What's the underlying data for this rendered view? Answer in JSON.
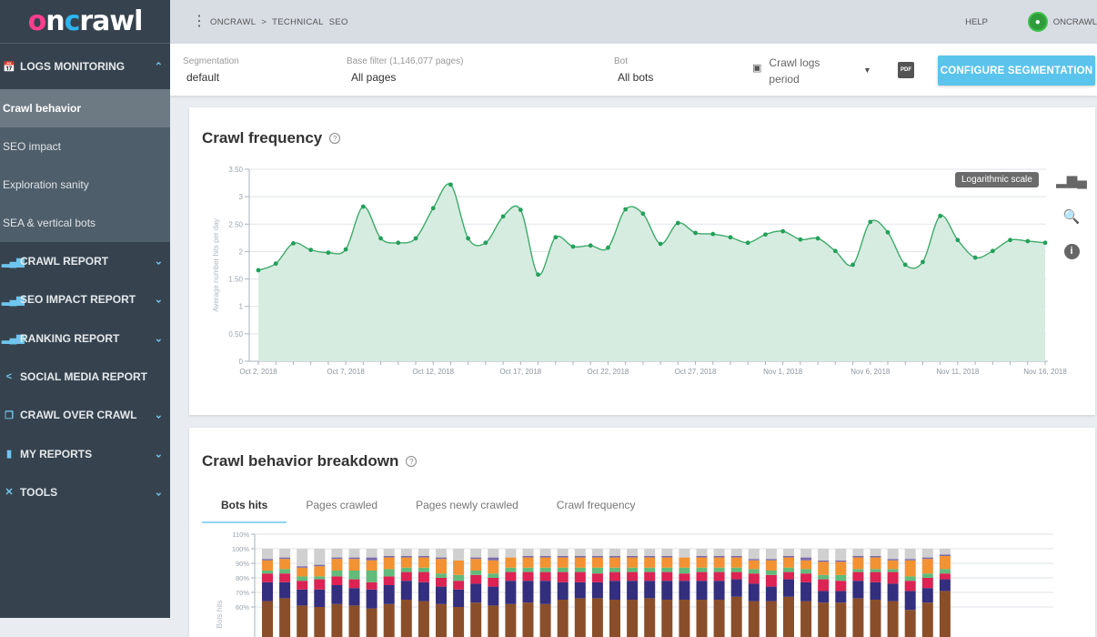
{
  "brand": {
    "logo_parts": [
      "o",
      "n",
      "c",
      "rawl"
    ]
  },
  "topbar": {
    "breadcrumb": [
      "ONCRAWL",
      "TECHNICAL",
      "SEO"
    ],
    "breadcrumb_separator": ">",
    "help_label": "HELP",
    "user_label": "ONCRAWL"
  },
  "sidebar": {
    "open_section": {
      "label": "LOGS MONITORING",
      "icon": "calendar-icon",
      "chevron": "chevron-up-icon"
    },
    "sub_items": [
      {
        "label": "Crawl behavior",
        "active": true
      },
      {
        "label": "SEO impact",
        "active": false
      },
      {
        "label": "Exploration sanity",
        "active": false
      },
      {
        "label": "SEA & vertical bots",
        "active": false
      }
    ],
    "sections": [
      {
        "label": "CRAWL REPORT",
        "icon": "bar-chart-icon",
        "has_chevron": true
      },
      {
        "label": "SEO IMPACT REPORT",
        "icon": "bar-chart-icon",
        "has_chevron": true
      },
      {
        "label": "RANKING REPORT",
        "icon": "bar-chart-icon",
        "has_chevron": true
      },
      {
        "label": "SOCIAL MEDIA REPORT",
        "icon": "share-icon",
        "has_chevron": false
      },
      {
        "label": "CRAWL OVER CRAWL",
        "icon": "copy-icon",
        "has_chevron": true
      },
      {
        "label": "MY REPORTS",
        "icon": "folder-icon",
        "has_chevron": true
      },
      {
        "label": "TOOLS",
        "icon": "tools-icon",
        "has_chevron": true
      }
    ]
  },
  "filters": {
    "segmentation": {
      "label": "Segmentation",
      "value": "default"
    },
    "base_filter": {
      "label": "Base filter (1,146,077 pages)",
      "value": "All pages"
    },
    "bot": {
      "label": "Bot",
      "value": "All bots"
    },
    "period": {
      "line1": "Crawl logs",
      "line2": "period"
    },
    "pdf_label": "PDF",
    "configure_button": "CONFIGURE SEGMENTATION"
  },
  "crawl_frequency_card": {
    "title": "Crawl frequency",
    "help": "?",
    "log_scale_label": "Logarithmic scale"
  },
  "breakdown_card": {
    "title": "Crawl behavior breakdown",
    "help": "?",
    "tabs": [
      {
        "label": "Bots hits",
        "active": true
      },
      {
        "label": "Pages crawled",
        "active": false
      },
      {
        "label": "Pages newly crawled",
        "active": false
      },
      {
        "label": "Crawl frequency",
        "active": false
      }
    ]
  },
  "colors": {
    "accent": "#5ac4ec",
    "line": "#3daa6a",
    "area": "#d5ebdf",
    "stack": [
      "#8a4f2a",
      "#342e7e",
      "#dc2353",
      "#62bb7a",
      "#f29233",
      "#7c6aa8",
      "#d0d0d0"
    ]
  },
  "chart_data": [
    {
      "type": "area",
      "title": "Crawl frequency",
      "xlabel": "",
      "ylabel": "Average number hits per day",
      "ylim": [
        0,
        3.5
      ],
      "yticks": [
        "0",
        "0.50",
        "1",
        "1.50",
        "2",
        "2.50",
        "3",
        "3.50"
      ],
      "ytick_values": [
        0,
        0.5,
        1,
        1.5,
        2,
        2.5,
        3,
        3.5
      ],
      "xtick_labels": [
        "Oct 2, 2018",
        "Oct 7, 2018",
        "Oct 12, 2018",
        "Oct 17, 2018",
        "Oct 22, 2018",
        "Oct 27, 2018",
        "Nov 1, 2018",
        "Nov 6, 2018",
        "Nov 11, 2018",
        "Nov 16, 2018"
      ],
      "xtick_every": 5,
      "grid": true,
      "x_start": "Oct 2, 2018",
      "values": [
        1.66,
        1.78,
        2.15,
        2.03,
        1.98,
        2.04,
        2.82,
        2.24,
        2.16,
        2.24,
        2.79,
        3.22,
        2.24,
        2.16,
        2.64,
        2.76,
        1.58,
        2.26,
        2.09,
        2.11,
        2.07,
        2.77,
        2.69,
        2.14,
        2.52,
        2.34,
        2.32,
        2.26,
        2.16,
        2.31,
        2.37,
        2.22,
        2.24,
        2.01,
        1.76,
        2.54,
        2.35,
        1.76,
        1.81,
        2.65,
        2.21,
        1.89,
        2.01,
        2.21,
        2.19,
        2.16
      ]
    },
    {
      "type": "bar",
      "stacked": true,
      "title": "Bots hits",
      "ylabel": "Bots hits",
      "ylim_visible": [
        55,
        110
      ],
      "yticks": [
        "60%",
        "70%",
        "80%",
        "90%",
        "100%",
        "110%"
      ],
      "ytick_values": [
        60,
        70,
        80,
        90,
        100,
        110
      ],
      "series_top_percent_by_bar": {
        "brown": [
          64,
          66,
          61,
          60,
          62,
          61,
          59,
          62,
          65,
          64,
          62,
          60,
          63,
          61,
          62,
          63,
          62,
          65,
          66,
          66,
          65,
          65,
          66,
          65,
          65,
          65,
          65,
          67,
          64,
          64,
          67,
          64,
          63,
          63,
          66,
          65,
          64,
          58,
          63,
          71
        ],
        "navy": [
          77,
          77,
          72,
          72,
          75,
          73,
          72,
          75,
          78,
          77,
          74,
          72,
          76,
          74,
          78,
          78,
          78,
          77,
          77,
          77,
          78,
          78,
          78,
          78,
          78,
          78,
          78,
          79,
          76,
          74,
          79,
          77,
          71,
          71,
          78,
          77,
          76,
          71,
          73,
          79
        ],
        "red": [
          83,
          83,
          78,
          79,
          81,
          79,
          77,
          81,
          84,
          84,
          80,
          78,
          82,
          80,
          84,
          84,
          84,
          84,
          84,
          83,
          84,
          84,
          84,
          84,
          83,
          84,
          84,
          84,
          83,
          82,
          84,
          83,
          79,
          78,
          84,
          84,
          84,
          78,
          80,
          83
        ],
        "green": [
          85,
          86,
          81,
          81,
          85,
          85,
          85,
          86,
          87,
          87,
          83,
          82,
          85,
          83,
          87,
          87,
          87,
          87,
          87,
          87,
          87,
          87,
          87,
          87,
          87,
          87,
          87,
          87,
          86,
          85,
          87,
          86,
          82,
          82,
          86,
          86,
          86,
          81,
          83,
          86
        ],
        "orange": [
          92,
          93,
          87,
          88,
          93,
          93,
          92,
          94,
          94,
          94,
          93,
          92,
          93,
          92,
          94,
          94,
          94,
          94,
          94,
          94,
          94,
          94,
          94,
          94,
          94,
          94,
          94,
          94,
          92,
          92,
          94,
          92,
          91,
          91,
          94,
          94,
          92,
          92,
          93,
          95
        ],
        "purple": [
          93,
          94,
          88,
          89,
          94,
          94,
          94,
          95,
          95,
          95,
          94,
          92,
          94,
          94,
          94,
          95,
          95,
          95,
          95,
          95,
          95,
          95,
          95,
          95,
          94,
          95,
          95,
          95,
          93,
          93,
          95,
          94,
          92,
          92,
          95,
          95,
          93,
          93,
          94,
          96
        ],
        "gray": [
          100,
          100,
          100,
          100,
          100,
          100,
          100,
          100,
          100,
          100,
          100,
          100,
          100,
          100,
          100,
          100,
          100,
          100,
          100,
          100,
          100,
          100,
          100,
          100,
          100,
          100,
          100,
          100,
          100,
          100,
          100,
          100,
          100,
          100,
          100,
          100,
          100,
          100,
          100,
          100
        ]
      }
    }
  ]
}
